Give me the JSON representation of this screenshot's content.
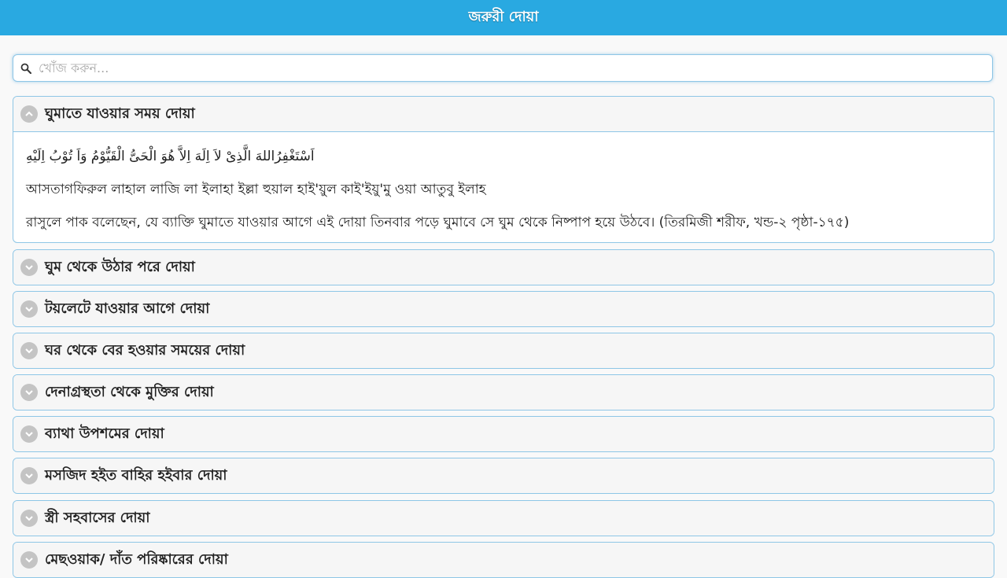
{
  "header": {
    "title": "জরুরী দোয়া"
  },
  "search": {
    "placeholder": "খোঁজ করুন..."
  },
  "duas": [
    {
      "title": "ঘুমাতে যাওয়ার সময় দোয়া",
      "expanded": true,
      "arabic": "اَسْتَغْفِرُاللهَ الَّذِىْ لاَ اِلَهَ اِلاَّ هُوَ الْحَىُّ الْقَيُّوْمُ وَاَ تُوْبُ اِلَيْهِ",
      "transliteration": "আসতাগফিরুল লাহাল লাজি লা ইলাহা ইল্লা হুয়াল হাই'য়ুল কাই'ইয়ু'মু ওয়া আতুবু ইলাহ",
      "description": "রাসুলে পাক বলেছেন, যে ব্যাক্তি ঘুমাতে যাওয়ার আগে এই দোয়া তিনবার পড়ে ঘুমাবে সে ঘুম থেকে নিষ্পাপ হয়ে উঠবে। (তিরমিজী শরীফ, খন্ড-২ পৃষ্ঠা-১৭৫)"
    },
    {
      "title": "ঘুম থেকে উঠার পরে দোয়া",
      "expanded": false
    },
    {
      "title": "টয়লেটে যাওয়ার আগে দোয়া",
      "expanded": false
    },
    {
      "title": "ঘর থেকে বের হওয়ার সময়ের দোয়া",
      "expanded": false
    },
    {
      "title": "দেনাগ্রস্থতা থেকে মুক্তির দোয়া",
      "expanded": false
    },
    {
      "title": "ব্যাথা উপশমের দোয়া",
      "expanded": false
    },
    {
      "title": "মসজিদ হইত বাহির হইবার দোয়া",
      "expanded": false
    },
    {
      "title": "স্ত্রী সহবাসের দোয়া",
      "expanded": false
    },
    {
      "title": "মেছওয়াক/ দাঁত পরিষ্কারের দোয়া",
      "expanded": false
    }
  ],
  "colors": {
    "header_bg": "#29a9e1",
    "border": "#8ec6e6",
    "chevron_bg": "#c4c4c4"
  },
  "icons": {
    "search": "search-icon",
    "collapse": "chevron-up-icon",
    "expand": "chevron-down-icon"
  }
}
